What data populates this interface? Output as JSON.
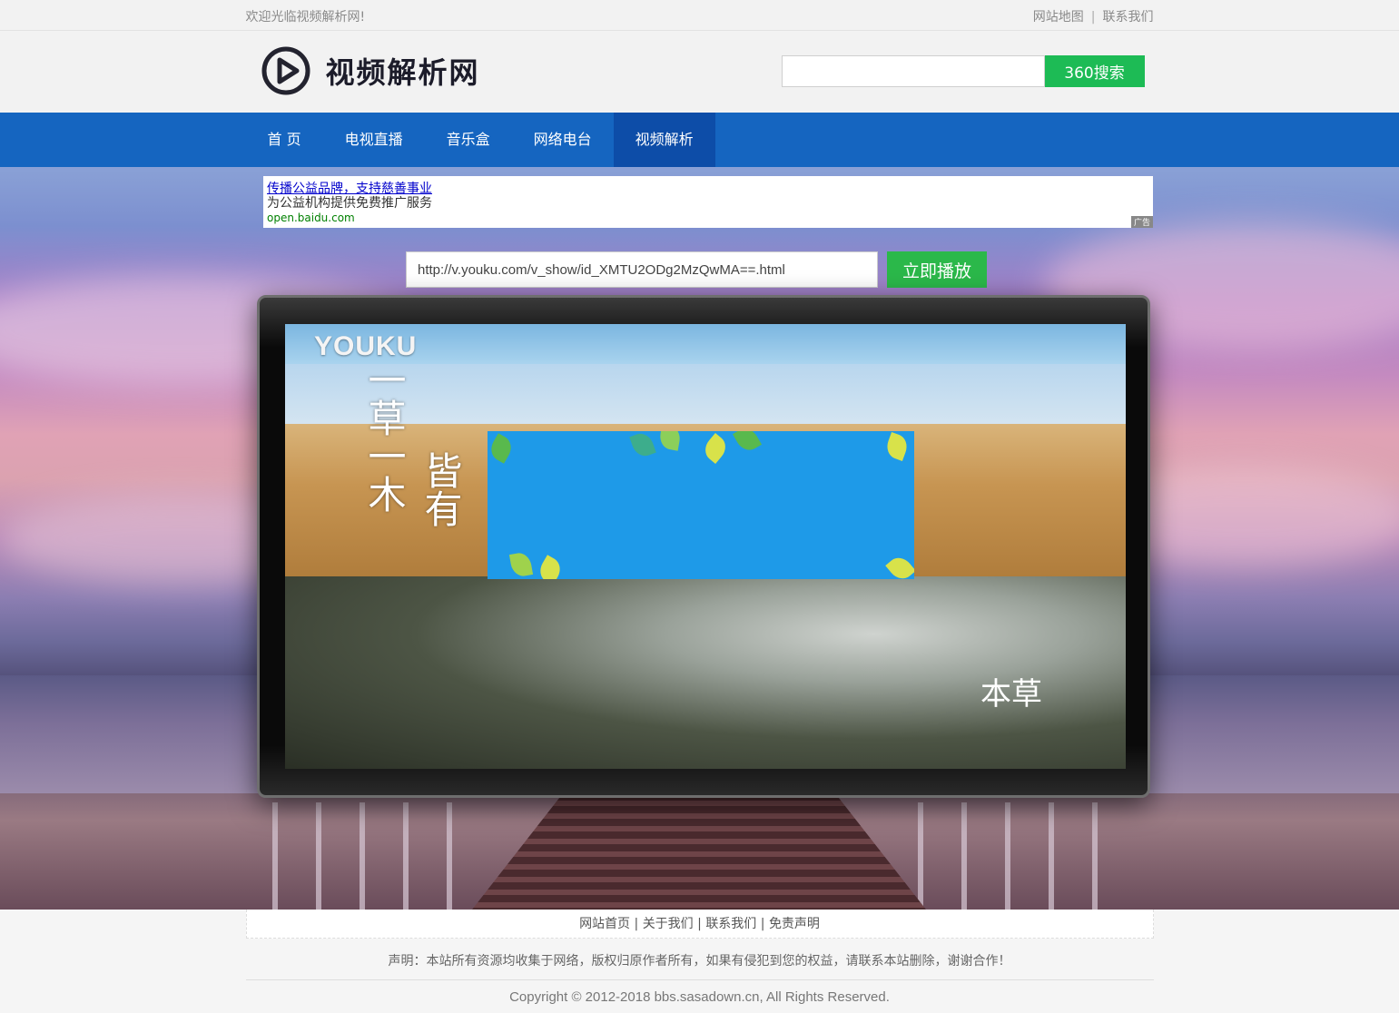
{
  "topbar": {
    "welcome": "欢迎光临视频解析网!",
    "links": [
      "网站地图",
      "联系我们"
    ],
    "separator": "|"
  },
  "header": {
    "logo_text": "视频解析网",
    "search": {
      "value": "",
      "placeholder": "",
      "button_label": "360搜索"
    }
  },
  "nav": {
    "items": [
      {
        "label": "首 页"
      },
      {
        "label": "电视直播"
      },
      {
        "label": "音乐盒"
      },
      {
        "label": "网络电台"
      },
      {
        "label": "视频解析",
        "active": true
      }
    ]
  },
  "ad": {
    "title": "传播公益品牌，支持慈善事业",
    "description": "为公益机构提供免费推广服务",
    "url": "open.baidu.com",
    "tag": "广告"
  },
  "player": {
    "url_value": "http://v.youku.com/v_show/id_XMTU2ODg2MzQwMA==.html",
    "play_button_label": "立即播放",
    "video": {
      "watermark": "YOUKU",
      "calligraphy_1": "一草一木",
      "calligraphy_2": "皆有",
      "brand_mark": "本草"
    }
  },
  "footer": {
    "links": [
      "网站首页",
      "关于我们",
      "联系我们",
      "免责声明"
    ],
    "separator": " | ",
    "notice": "声明：本站所有资源均收集于网络，版权归原作者所有，如果有侵犯到您的权益，请联系本站删除，谢谢合作！",
    "copyright": "Copyright © 2012-2018 bbs.sasadown.cn, All Rights Reserved."
  },
  "colors": {
    "nav_bg": "#1565c0",
    "nav_active": "#0d4da8",
    "search_button": "#1dbb55",
    "play_button": "#2bb84a"
  }
}
